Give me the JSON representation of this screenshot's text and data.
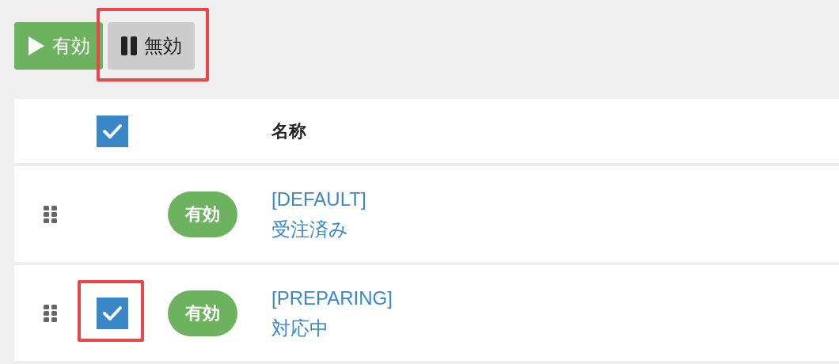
{
  "toolbar": {
    "buttons": [
      {
        "kind": "play",
        "label": "有効",
        "color": "#6cb25f",
        "highlighted": false
      },
      {
        "kind": "pause",
        "label": "無効",
        "color": "#cccccc",
        "highlighted": true
      }
    ]
  },
  "table": {
    "header": {
      "checked": true,
      "column": "名称"
    },
    "rows": [
      {
        "selectable": false,
        "status": "有効",
        "code": "[DEFAULT]",
        "name": "受注済み"
      },
      {
        "selectable": true,
        "checked": true,
        "highlighted": true,
        "status": "有効",
        "code": "[PREPARING]",
        "name": "対応中"
      }
    ]
  }
}
